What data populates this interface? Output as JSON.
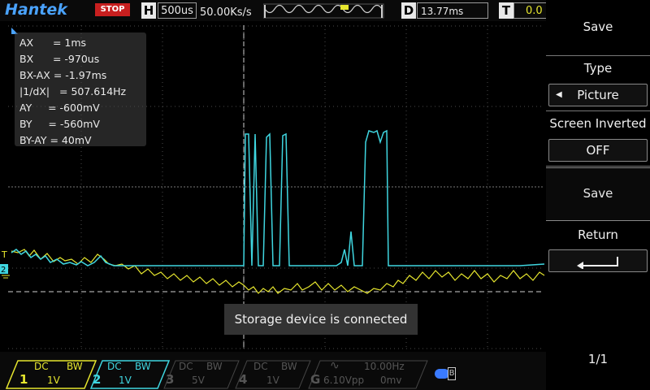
{
  "topbar": {
    "brand": "Hantek",
    "run_state": "STOP",
    "horiz_tag": "H",
    "timebase": "500us",
    "sample_rate": "50.00Ks/s",
    "delay_tag": "D",
    "delay": "13.77ms",
    "trigger_tag": "T",
    "trigger_level": "0.0"
  },
  "measurements": {
    "ax": "AX      = 1ms",
    "bx": "BX      = -970us",
    "bx_ax": "BX-AX = -1.97ms",
    "freq": "|1/dX|   = 507.614Hz",
    "ay": "AY     = -600mV",
    "by": "BY     = -560mV",
    "by_ay": "BY-AY = 40mV"
  },
  "toast": "Storage device is connected",
  "menu": {
    "title": "Save",
    "type_label": "Type",
    "type_value": "Picture",
    "inverted_label": "Screen Inverted",
    "inverted_value": "OFF",
    "save_button": "Save",
    "return_label": "Return",
    "page": "1/1"
  },
  "channels": [
    {
      "num": "1",
      "coupling": "DC",
      "bw": "BW",
      "scale": "1V",
      "color": "#e6e62e",
      "active": true
    },
    {
      "num": "2",
      "coupling": "DC",
      "bw": "BW",
      "scale": "1V",
      "color": "#3fd6e0",
      "active": true
    },
    {
      "num": "3",
      "coupling": "DC",
      "bw": "BW",
      "scale": "5V",
      "color": "#555555",
      "active": false
    },
    {
      "num": "4",
      "coupling": "DC",
      "bw": "BW",
      "scale": "1V",
      "color": "#555555",
      "active": false
    }
  ],
  "generator": {
    "tag": "G",
    "freq": "10.00Hz",
    "vpp": "6.10Vpp",
    "offset": "0mv"
  },
  "markers": {
    "ch1": "1",
    "ch2": "2"
  },
  "colors": {
    "ch1": "#e6e62e",
    "ch2": "#3fd6e0",
    "accent": "#4aa3ff",
    "stop": "#c81f1f"
  }
}
